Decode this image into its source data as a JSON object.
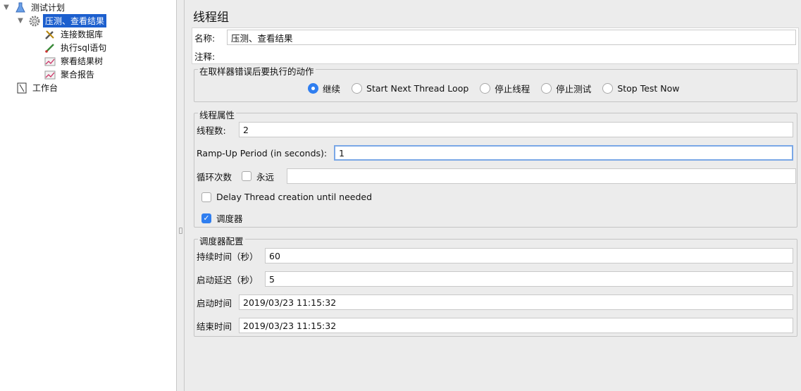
{
  "tree": {
    "items": [
      {
        "label": "测试计划"
      },
      {
        "label": "压测、查看结果"
      },
      {
        "label": "连接数据库"
      },
      {
        "label": "执行sql语句"
      },
      {
        "label": "察看结果树"
      },
      {
        "label": "聚合报告"
      },
      {
        "label": "工作台"
      }
    ]
  },
  "panel": {
    "title": "线程组",
    "name_label": "名称:",
    "name_value": "压测、查看结果",
    "comment_label": "注释:",
    "comment_value": "",
    "on_error": {
      "legend": "在取样器错误后要执行的动作",
      "options": [
        {
          "label": "继续",
          "selected": true
        },
        {
          "label": "Start Next Thread Loop",
          "selected": false
        },
        {
          "label": "停止线程",
          "selected": false
        },
        {
          "label": "停止测试",
          "selected": false
        },
        {
          "label": "Stop Test Now",
          "selected": false
        }
      ]
    },
    "thread_props": {
      "legend": "线程属性",
      "threads_label": "线程数:",
      "threads_value": "2",
      "rampup_label": "Ramp-Up Period (in seconds):",
      "rampup_value": "1",
      "loop_label": "循环次数",
      "forever_label": "永远",
      "forever_checked": false,
      "loop_value": "",
      "delay_label": "Delay Thread creation until needed",
      "delay_checked": false,
      "scheduler_label": "调度器",
      "scheduler_checked": true
    },
    "scheduler": {
      "legend": "调度器配置",
      "duration_label": "持续时间（秒）",
      "duration_value": "60",
      "delay_label": "启动延迟（秒）",
      "delay_value": "5",
      "start_label": "启动时间",
      "start_value": "2019/03/23 11:15:32",
      "end_label": "结束时间",
      "end_value": "2019/03/23 11:15:32"
    }
  },
  "colors": {
    "accent": "#2f7ef0",
    "selection": "#1c5fce"
  }
}
